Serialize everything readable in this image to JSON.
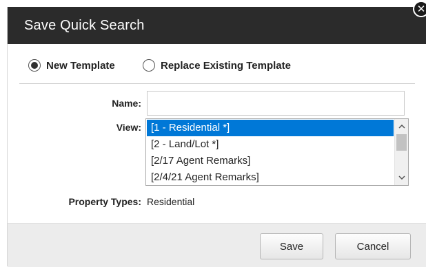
{
  "dialog": {
    "title": "Save Quick Search",
    "close_symbol": "✕"
  },
  "options": {
    "new_template": {
      "label": "New Template",
      "selected": true
    },
    "replace_existing": {
      "label": "Replace Existing Template",
      "selected": false
    }
  },
  "form": {
    "name_label": "Name:",
    "name_value": "",
    "name_placeholder": "",
    "view_label": "View:",
    "views": [
      {
        "label": "[1 - Residential *]",
        "selected": true
      },
      {
        "label": "[2 - Land/Lot *]",
        "selected": false
      },
      {
        "label": "[2/17 Agent Remarks]",
        "selected": false
      },
      {
        "label": "[2/4/21 Agent Remarks]",
        "selected": false
      }
    ],
    "property_types_label": "Property Types:",
    "property_types_value": "Residential"
  },
  "footer": {
    "save_label": "Save",
    "cancel_label": "Cancel"
  },
  "colors": {
    "titlebar": "#2b2b2b",
    "selection": "#0078d7",
    "footer": "#ececec"
  }
}
